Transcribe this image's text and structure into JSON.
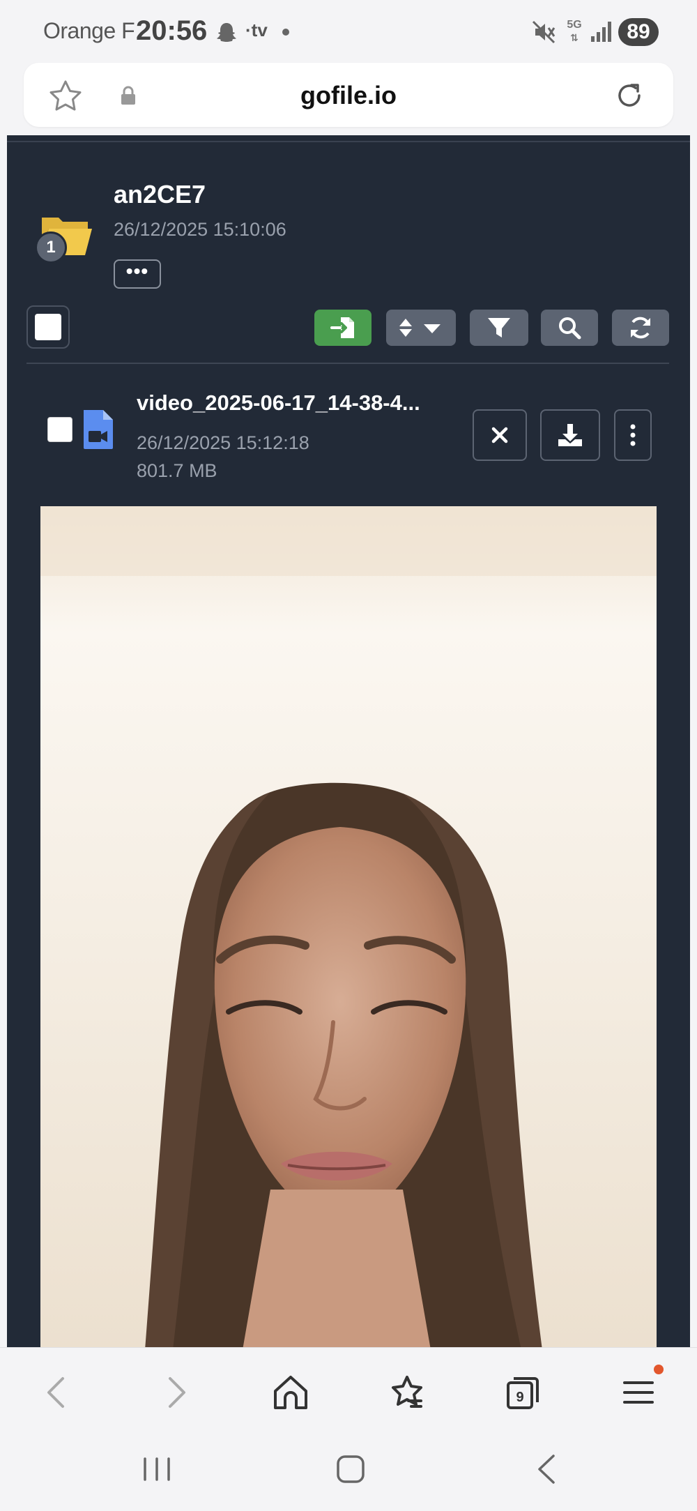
{
  "status_bar": {
    "carrier": "Orange F",
    "time": "20:56",
    "tv_label": "·tv",
    "network": "5G",
    "battery": "89"
  },
  "browser": {
    "url": "gofile.io",
    "tab_count": "9"
  },
  "folder": {
    "name": "an2CE7",
    "created": "26/12/2025 15:10:06",
    "badge_count": "1",
    "more_label": "•••"
  },
  "file": {
    "name": "video_2025-06-17_14-38-4...",
    "date": "26/12/2025 15:12:18",
    "size": "801.7 MB"
  },
  "icons": {
    "folder": "folder-open-icon",
    "file": "video-file-icon",
    "import": "import-icon",
    "sort": "sort-icon",
    "filter": "filter-icon",
    "search": "search-icon",
    "refresh": "refresh-icon",
    "close": "close-icon",
    "download": "download-icon",
    "menu": "vertical-ellipsis-icon"
  },
  "colors": {
    "panel_bg": "#222a37",
    "import_green": "#4a9e4f",
    "toolbar_button": "#5c6472",
    "folder_yellow": "#f2c94c",
    "file_blue": "#5b8def",
    "notification_dot": "#e2562c"
  }
}
